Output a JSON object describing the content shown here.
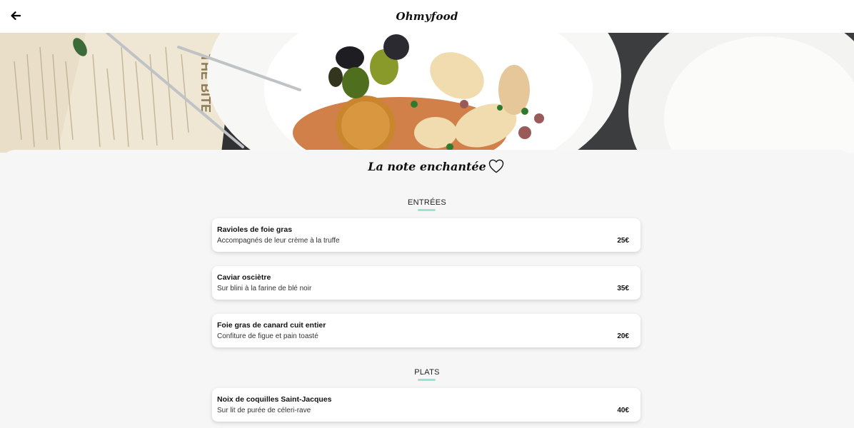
{
  "header": {
    "back_icon": "arrow-left-icon",
    "logo": "Ohmyfood"
  },
  "hero": {
    "description_icon": "food-photo"
  },
  "restaurant": {
    "name": "La note enchantée",
    "favorite_icon": "heart-outline-icon"
  },
  "sections": [
    {
      "title": "ENTRÉES",
      "items": [
        {
          "name": "Ravioles de foie gras",
          "description": "Accompagnés de leur crème à la truffe",
          "price": "25€"
        },
        {
          "name": "Caviar osciètre",
          "description": "Sur blini à la farine de blé noir",
          "price": "35€"
        },
        {
          "name": "Foie gras de canard cuit entier",
          "description": "Confiture de figue et pain toasté",
          "price": "20€"
        }
      ]
    },
    {
      "title": "PLATS",
      "items": [
        {
          "name": "Noix de coquilles Saint-Jacques",
          "description": "Sur lit de purée de céleri-rave",
          "price": "40€"
        }
      ]
    }
  ],
  "colors": {
    "accent_underline": "#99e2d0",
    "background": "#f6f6f6",
    "card": "#ffffff"
  }
}
